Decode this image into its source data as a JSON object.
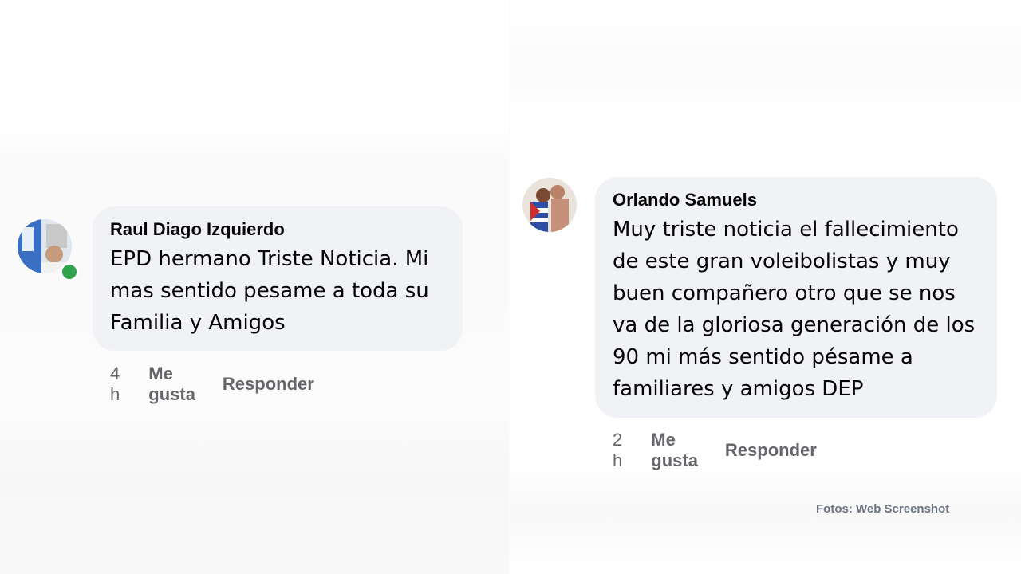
{
  "comments": [
    {
      "author": "Raul Diago Izquierdo",
      "text": "EPD hermano Triste Noticia. Mi\nmas sentido pesame a toda su\nFamilia y Amigos",
      "time": "4 h",
      "like_label": "Me gusta",
      "reply_label": "Responder",
      "online": true,
      "avatar_icon": "profile-photo-icon"
    },
    {
      "author": "Orlando Samuels",
      "text": "Muy triste noticia el fallecimiento\nde este gran voleibolistas y muy\nbuen compañero otro que se nos\nva de la gloriosa generación de los\n90 mi más sentido pésame a\nfamiliares y amigos DEP",
      "time": "2 h",
      "like_label": "Me gusta",
      "reply_label": "Responder",
      "online": false,
      "avatar_icon": "profile-photo-icon"
    }
  ],
  "credit": "Fotos: Web Screenshot",
  "colors": {
    "bubble_bg": "#f0f2f5",
    "text": "#050505",
    "meta": "#65676b",
    "online": "#31a24c"
  }
}
